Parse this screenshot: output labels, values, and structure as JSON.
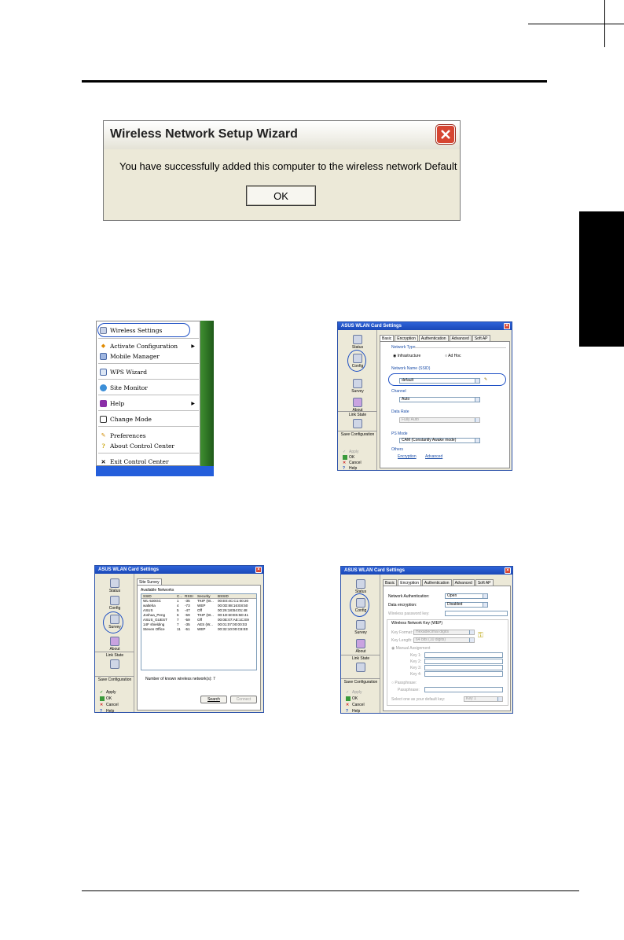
{
  "dialog": {
    "title": "Wireless Network Setup Wizard",
    "message": "You have successfully added this computer to the wireless network Default",
    "ok_label": "OK"
  },
  "context_menu": {
    "items": [
      {
        "label": "Wireless Settings",
        "icon": "settings-icon",
        "submenu": false
      },
      {
        "label": "Activate Configuration",
        "icon": "diamond-icon",
        "submenu": true
      },
      {
        "label": "Mobile Manager",
        "icon": "monitor-icon",
        "submenu": false
      },
      {
        "label": "WPS Wizard",
        "icon": "wps-icon",
        "submenu": false
      },
      {
        "label": "Site Monitor",
        "icon": "globe-icon",
        "submenu": false
      },
      {
        "label": "Help",
        "icon": "book-icon",
        "submenu": true
      },
      {
        "label": "Change Mode",
        "icon": "mode-icon",
        "submenu": false
      },
      {
        "label": "Preferences",
        "icon": "pencil-icon",
        "submenu": false
      },
      {
        "label": "About Control Center",
        "icon": "question-icon",
        "submenu": false
      },
      {
        "label": "Exit Control Center",
        "icon": "close-icon",
        "submenu": false
      }
    ]
  },
  "asus_common": {
    "window_title": "ASUS WLAN Card Settings",
    "nav": {
      "status": "Status",
      "config": "Config",
      "survey": "Survey",
      "about": "About",
      "link_state": "Link State",
      "save_configuration": "Save Configuration",
      "apply": "Apply",
      "ok": "OK",
      "cancel": "Cancel",
      "help": "Help"
    }
  },
  "config_basic": {
    "tabs": [
      "Basic",
      "Encryption",
      "Authentication",
      "Advanced",
      "Soft AP"
    ],
    "network_type_label": "Network Type",
    "infrastructure": "Infrastructure",
    "adhoc": "Ad Hoc",
    "ssid_label": "Network Name (SSID)",
    "ssid_value": "default",
    "channel_label": "Channel",
    "channel_value": "Auto",
    "data_rate_label": "Data Rate",
    "data_rate_value": "Fully Auto",
    "ps_mode_label": "PS Mode",
    "ps_mode_value": "CAM (Constantly Awake mode)",
    "others_label": "Others",
    "encryption_link": "Encryption",
    "advanced_link": "Advanced"
  },
  "survey": {
    "tab": "Site Survey",
    "available_label": "Available Networks",
    "columns": [
      "SSID",
      "C...",
      "RSSI",
      "Security",
      "BSSID"
    ],
    "rows": [
      [
        "WL-530GC",
        "1",
        "-35",
        "TKIP (W...",
        "00:E0:4C:C1:00:20"
      ],
      [
        "walteha",
        "4",
        "-73",
        "WEP",
        "00:0D:88:16:E8:50"
      ],
      [
        "ASUS",
        "5",
        "-47",
        "Off",
        "00:26:18:B4:01:48"
      ],
      [
        "Joshua_Peng",
        "6",
        "-59",
        "TKIP (W...",
        "00:1D:60:E5:5D:41"
      ],
      [
        "ASUS_GUEST",
        "7",
        "-59",
        "Off",
        "00:0E:07:AE:1C:E9"
      ],
      [
        "14F shielding",
        "7",
        "-35",
        "AES (W...",
        "00:01:07:00:00:03"
      ],
      [
        "Steven Office",
        "11",
        "-51",
        "WEP",
        "00:32:10:00:C8:E0"
      ]
    ],
    "count_text": "Number of known wireless network(s): 7",
    "search_label": "Search",
    "connect_label": "Connect"
  },
  "config_encryption": {
    "tabs": [
      "Basic",
      "Encryption",
      "Authentication",
      "Advanced",
      "Soft AP"
    ],
    "auth_label": "Network Authentication:",
    "auth_value": "Open",
    "enc_label": "Data encryption:",
    "enc_value": "Disabled",
    "passphrase_label": "Wireless password key:",
    "wep_group": "Wireless Network Key (WEP)",
    "key_format_label": "Key Format:",
    "key_format_value": "Hexadecimal digits",
    "key_length_label": "Key Length:",
    "key_length_value": "64 bits (10 digits)",
    "manual_label": "Manual Assignment",
    "key1": "Key 1:",
    "key2": "Key 2:",
    "key3": "Key 3:",
    "key4": "Key 4:",
    "passphrase_radio": "Passphrase:",
    "passphrase_field_label": "Passphrase:",
    "default_key_label": "Select one as your default key:",
    "default_key_value": "Key 1"
  }
}
